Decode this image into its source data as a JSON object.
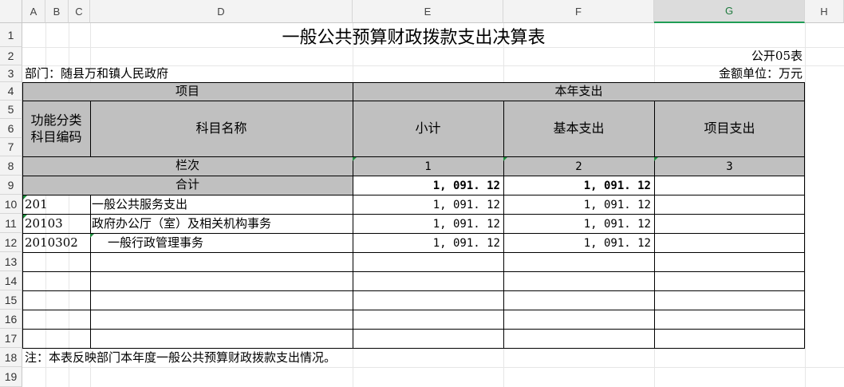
{
  "columns": [
    "A",
    "B",
    "C",
    "D",
    "E",
    "F",
    "G",
    "H"
  ],
  "rows": [
    "1",
    "2",
    "3",
    "4",
    "5",
    "6",
    "7",
    "8",
    "9",
    "10",
    "11",
    "12",
    "13",
    "14",
    "15",
    "16",
    "17",
    "18",
    "19"
  ],
  "title": "一般公共预算财政拨款支出决算表",
  "form_code": "公开05表",
  "department": "部门：随县万和镇人民政府",
  "unit": "金额单位：万元",
  "header": {
    "item": "项目",
    "current_year": "本年支出",
    "func_code_line1": "功能分类",
    "func_code_line2": "科目编码",
    "subject_name": "科目名称",
    "subtotal": "小计",
    "basic": "基本支出",
    "project": "项目支出",
    "col_order": "栏次",
    "col1": "1",
    "col2": "2",
    "col3": "3",
    "total_label": "合计",
    "total_subtotal": "1, 091. 12",
    "total_basic": "1, 091. 12",
    "total_project": ""
  },
  "items": [
    {
      "code": "201",
      "name": "一般公共服务支出",
      "subtotal": "1, 091. 12",
      "basic": "1, 091. 12",
      "project": ""
    },
    {
      "code": "20103",
      "name": "政府办公厅（室）及相关机构事务",
      "subtotal": "1, 091. 12",
      "basic": "1, 091. 12",
      "project": ""
    },
    {
      "code": "2010302",
      "name": "一般行政管理事务",
      "subtotal": "1, 091. 12",
      "basic": "1, 091. 12",
      "project": ""
    }
  ],
  "note": "注：本表反映部门本年度一般公共预算财政拨款支出情况。",
  "colors": {
    "header_gray": "#c0c0c0",
    "selected_col": "#1f9d55",
    "comment_marker": "#1e8e3e"
  }
}
